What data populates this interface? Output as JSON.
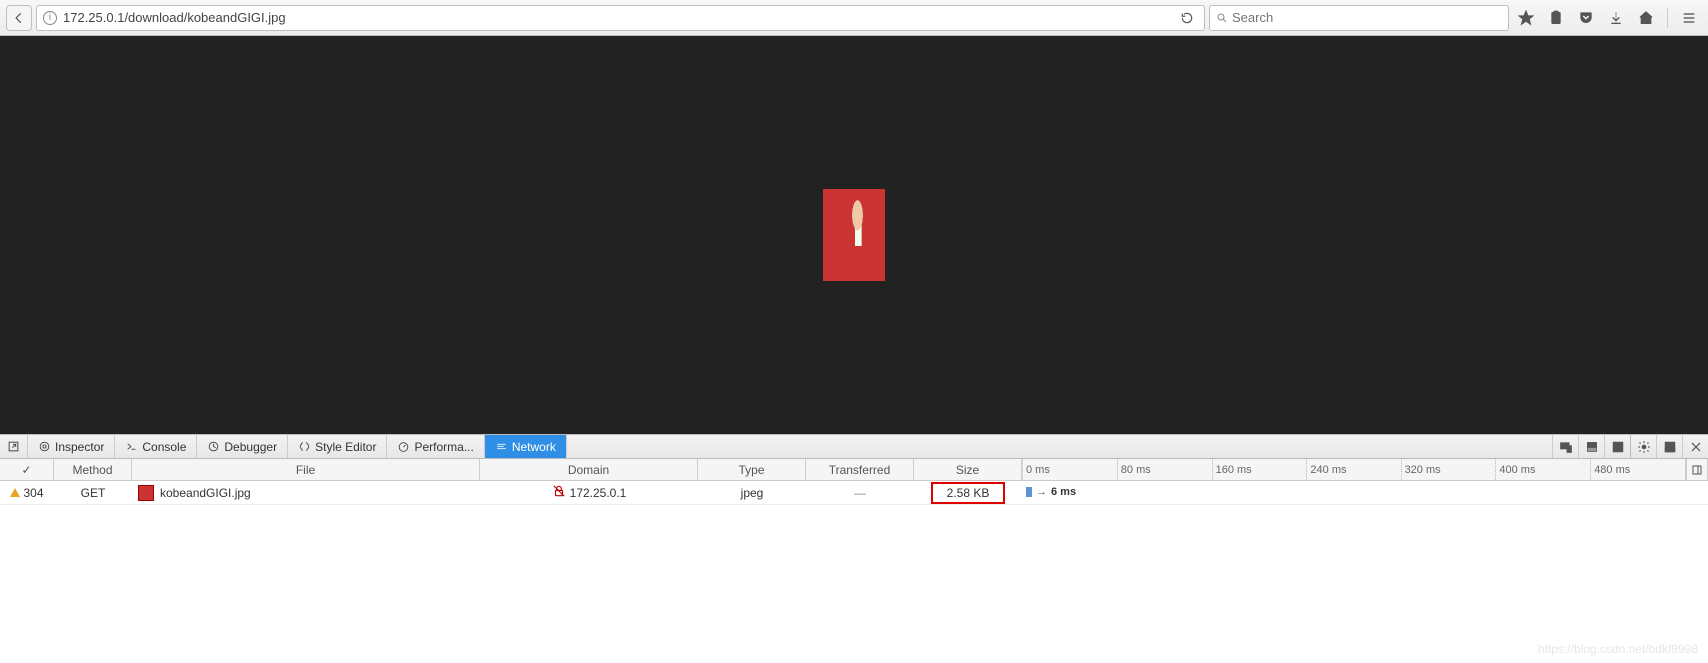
{
  "url": "172.25.0.1/download/kobeandGIGI.jpg",
  "search": {
    "placeholder": "Search"
  },
  "devtools": {
    "tabs": {
      "inspector": "Inspector",
      "console": "Console",
      "debugger": "Debugger",
      "style": "Style Editor",
      "performance": "Performa...",
      "network": "Network"
    }
  },
  "columns": {
    "status": "✓",
    "method": "Method",
    "file": "File",
    "domain": "Domain",
    "type": "Type",
    "transferred": "Transferred",
    "size": "Size"
  },
  "ticks": [
    "0 ms",
    "80 ms",
    "160 ms",
    "240 ms",
    "320 ms",
    "400 ms",
    "480 ms"
  ],
  "row": {
    "status": "304",
    "method": "GET",
    "file": "kobeandGIGI.jpg",
    "domain": "172.25.0.1",
    "type": "jpeg",
    "transferred": "—",
    "size": "2.58 KB",
    "timing": "6 ms"
  },
  "watermark": "https://blog.csdn.net/bdkf9998"
}
